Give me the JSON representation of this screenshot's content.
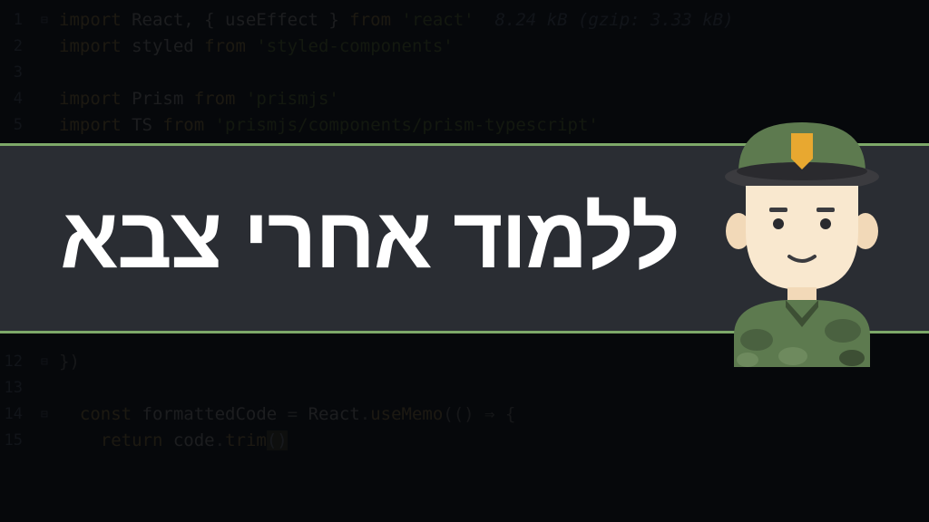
{
  "banner_text": "ללמוד אחרי צבא",
  "code": {
    "lines": [
      {
        "n": "1",
        "fold": "⊟",
        "tokens": [
          {
            "t": "import ",
            "c": "kw"
          },
          {
            "t": "React, { useEffect } ",
            "c": "id"
          },
          {
            "t": "from ",
            "c": "kw"
          },
          {
            "t": "'react'",
            "c": "str"
          },
          {
            "t": "  8.24 kB (gzip: 3.33 kB)",
            "c": "comment"
          }
        ]
      },
      {
        "n": "2",
        "fold": "",
        "tokens": [
          {
            "t": "import ",
            "c": "kw"
          },
          {
            "t": "styled ",
            "c": "id"
          },
          {
            "t": "from ",
            "c": "kw"
          },
          {
            "t": "'styled-components'",
            "c": "str"
          }
        ]
      },
      {
        "n": "3",
        "fold": "",
        "tokens": []
      },
      {
        "n": "4",
        "fold": "",
        "tokens": [
          {
            "t": "import ",
            "c": "kw"
          },
          {
            "t": "Prism ",
            "c": "id"
          },
          {
            "t": "from ",
            "c": "kw"
          },
          {
            "t": "'prismjs'",
            "c": "str"
          }
        ]
      },
      {
        "n": "5",
        "fold": "",
        "tokens": [
          {
            "t": "import ",
            "c": "kw"
          },
          {
            "t": "TS ",
            "c": "id"
          },
          {
            "t": "from ",
            "c": "kw"
          },
          {
            "t": "'prismjs/components/prism-typescript'",
            "c": "str"
          }
        ]
      },
      {
        "n": "",
        "fold": "",
        "tokens": []
      },
      {
        "n": "",
        "fold": "",
        "tokens": []
      },
      {
        "n": "",
        "fold": "",
        "tokens": []
      },
      {
        "n": "",
        "fold": "",
        "tokens": []
      },
      {
        "n": "",
        "fold": "",
        "tokens": []
      },
      {
        "n": "",
        "fold": "",
        "tokens": []
      },
      {
        "n": "",
        "fold": "",
        "tokens": []
      },
      {
        "n": "",
        "fold": "",
        "tokens": []
      },
      {
        "n": "12",
        "fold": "⊟",
        "tokens": [
          {
            "t": "})",
            "c": "op"
          }
        ]
      },
      {
        "n": "13",
        "fold": "",
        "tokens": []
      },
      {
        "n": "14",
        "fold": "⊟",
        "tokens": [
          {
            "t": "  const ",
            "c": "kw"
          },
          {
            "t": "formattedCode ",
            "c": "id"
          },
          {
            "t": "= ",
            "c": "op"
          },
          {
            "t": "React",
            "c": "id"
          },
          {
            "t": ".",
            "c": "op"
          },
          {
            "t": "useMemo",
            "c": "fn"
          },
          {
            "t": "(() ⇒ {",
            "c": "op"
          }
        ]
      },
      {
        "n": "15",
        "fold": "",
        "tokens": [
          {
            "t": "    return ",
            "c": "kw"
          },
          {
            "t": "code",
            "c": "id"
          },
          {
            "t": ".",
            "c": "op"
          },
          {
            "t": "trim",
            "c": "fn"
          },
          {
            "t": "(",
            "c": "paren-hl"
          },
          {
            "t": ")",
            "c": "paren-hl"
          }
        ]
      }
    ]
  }
}
